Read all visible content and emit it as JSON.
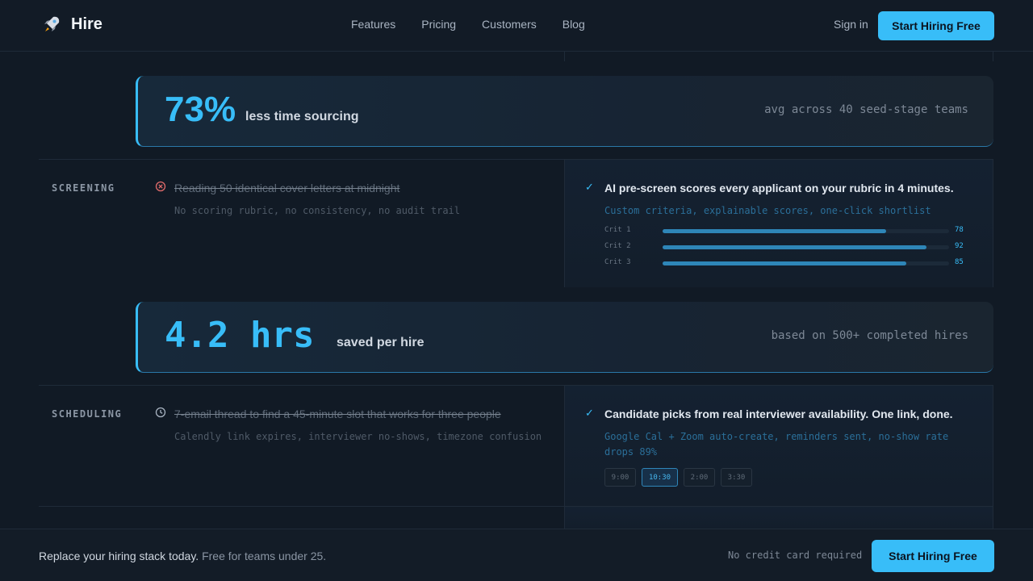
{
  "header": {
    "brand": "Hire",
    "brand_icon": "rocket-icon",
    "nav": [
      "Features",
      "Pricing",
      "Customers",
      "Blog"
    ],
    "signin": "Sign in",
    "cta": "Start Hiring Free"
  },
  "stats": [
    {
      "number": "73%",
      "label": "less time sourcing",
      "note": "avg across 40 seed-stage teams"
    },
    {
      "number": "4.2 hrs",
      "label": "saved per hire",
      "note": "based on 500+ completed hires"
    }
  ],
  "screening": {
    "label": "SCREENING",
    "pain_icon": "x-circle-icon",
    "pain_title": "Reading 50 identical cover letters at midnight",
    "pain_sub": "No scoring rubric, no consistency, no audit trail",
    "solution_title": "AI pre-screen scores every applicant on your rubric in 4 minutes.",
    "solution_sub": "Custom criteria, explainable scores, one-click shortlist",
    "criteria": [
      {
        "name": "Crit 1",
        "value": 78
      },
      {
        "name": "Crit 2",
        "value": 92
      },
      {
        "name": "Crit 3",
        "value": 85
      }
    ]
  },
  "scheduling": {
    "label": "SCHEDULING",
    "pain_icon": "clock-icon",
    "pain_title": "7-email thread to find a 45-minute slot that works for three people",
    "pain_sub": "Calendly link expires, interviewer no-shows, timezone confusion",
    "solution_title": "Candidate picks from real interviewer availability. One link, done.",
    "solution_sub": "Google Cal + Zoom auto-create, reminders sent, no-show rate drops 89%",
    "slots": [
      "9:00",
      "10:30",
      "2:00",
      "3:30"
    ],
    "selected_slot": "10:30"
  },
  "footer": {
    "main": "Replace your hiring stack today.",
    "muted": "Free for teams under 25.",
    "note": "No credit card required",
    "cta": "Start Hiring Free"
  },
  "colors": {
    "accent": "#38bdf8",
    "background": "#111a25"
  }
}
